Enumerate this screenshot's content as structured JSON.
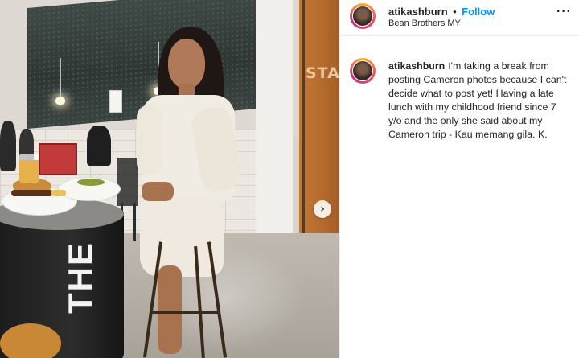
{
  "post": {
    "username": "atikashburn",
    "separator": "•",
    "follow_label": "Follow",
    "location": "Bean Brothers MY",
    "more_label": "···",
    "caption": "I'm taking a break from posting Cameron photos because I can't decide what to post yet! Having a late lunch with my childhood friend since 7 y/o and the only she said about my Cameron trip - Kau memang gila. K."
  },
  "photo": {
    "door_sign": "STA",
    "table_text": "THE",
    "next_label": "›"
  },
  "colors": {
    "follow_blue": "#0095f6",
    "text": "#262626"
  },
  "icons": {
    "next": "chevron-right-icon",
    "more": "more-options-icon",
    "avatar": "profile-avatar"
  }
}
